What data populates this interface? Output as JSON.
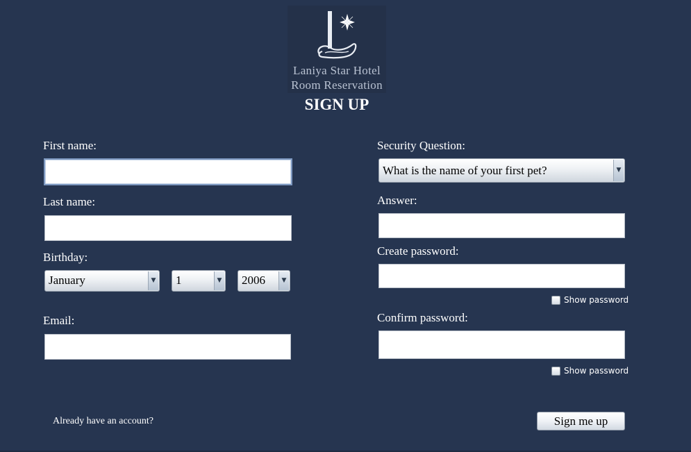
{
  "header": {
    "hotel_name": "Laniya Star Hotel",
    "subtitle": "Room Reservation",
    "page_title": "SIGN UP"
  },
  "form_left": {
    "first_name_label": "First name:",
    "first_name_value": "",
    "last_name_label": "Last name:",
    "last_name_value": "",
    "birthday_label": "Birthday:",
    "birthday_month": "January",
    "birthday_day": "1",
    "birthday_year": "2006",
    "email_label": "Email:",
    "email_value": ""
  },
  "form_right": {
    "security_question_label": "Security Question:",
    "security_question_value": "What is the name of your first pet?",
    "answer_label": "Answer:",
    "answer_value": "",
    "create_password_label": "Create password:",
    "create_password_value": "",
    "show_password_label_1": "Show password",
    "confirm_password_label": "Confirm password:",
    "confirm_password_value": "",
    "show_password_label_2": "Show password"
  },
  "footer": {
    "account_link": "Already have an account?",
    "sign_up_button": "Sign me up"
  },
  "colors": {
    "background": "#263550",
    "logo_text": "#b9c2d2",
    "text": "#ffffff"
  },
  "icons": {
    "logo": "hotel-star-logo",
    "dropdown": "triangle-down-icon"
  }
}
